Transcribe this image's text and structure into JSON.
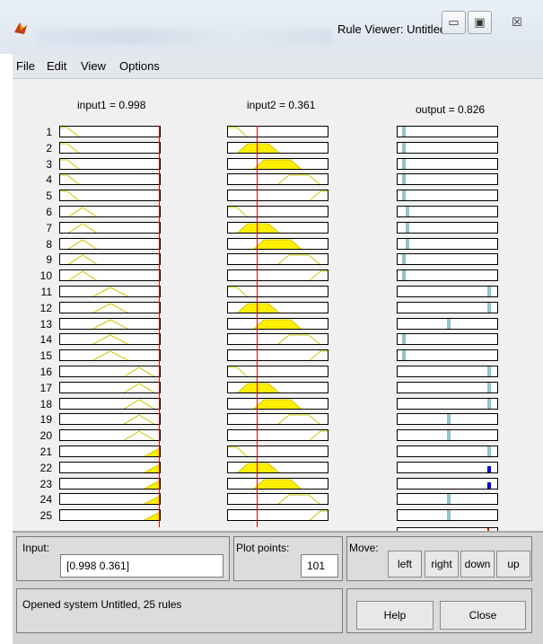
{
  "window": {
    "title": "Rule Viewer: Untitled",
    "controls": {
      "minimize": "▭",
      "maximize": "▣",
      "close": "☒"
    }
  },
  "menu": [
    "File",
    "Edit",
    "View",
    "Options"
  ],
  "variables": {
    "input1": "input1 = 0.998",
    "input2": "input2 = 0.361",
    "output": "output = 0.826"
  },
  "rules": [
    "1",
    "2",
    "3",
    "4",
    "5",
    "6",
    "7",
    "8",
    "9",
    "10",
    "11",
    "12",
    "13",
    "14",
    "15",
    "16",
    "17",
    "18",
    "19",
    "20",
    "21",
    "22",
    "23",
    "24",
    "25"
  ],
  "colors": {
    "fill": "#ffee00",
    "outline": "#c8c800",
    "output_bar": "#8fc4cc",
    "output_bar_dark": "#0000cc",
    "indicator": "#e00000"
  },
  "input_panel": {
    "label": "Input:",
    "value": "[0.998 0.361]"
  },
  "plot_panel": {
    "label": "Plot points:",
    "value": "101"
  },
  "move_panel": {
    "label": "Move:",
    "left": "left",
    "right": "right",
    "down": "down",
    "up": "up"
  },
  "status": {
    "text": "Opened system Untitled, 25 rules"
  },
  "buttons": {
    "help": "Help",
    "close": "Close"
  }
}
